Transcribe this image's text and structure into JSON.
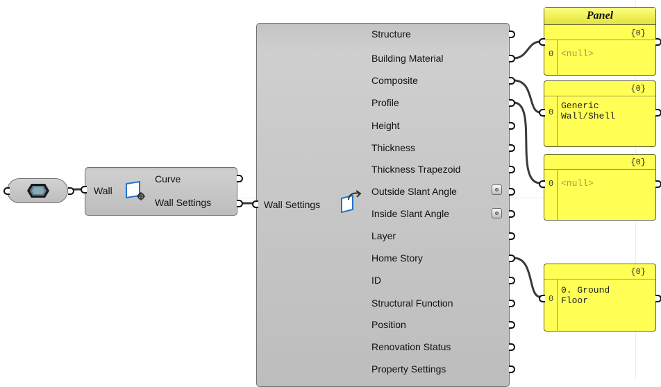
{
  "app": {
    "name": "Grasshopper canvas"
  },
  "source_component": {
    "icon": "archicad-element-icon"
  },
  "wall_settings_component": {
    "input_label": "Wall",
    "outputs": [
      "Curve",
      "Wall Settings"
    ],
    "icon": "wall-settings-icon"
  },
  "deconstruct_component": {
    "input_label": "Wall Settings",
    "icon": "deconstruct-wall-icon",
    "outputs": [
      "Structure",
      "Building Material",
      "Composite",
      "Profile",
      "Height",
      "Thickness",
      "Thickness Trapezoid",
      "Outside Slant Angle",
      "Inside Slant Angle",
      "Layer",
      "Home Story",
      "ID",
      "Structural Function",
      "Position",
      "Renovation Status",
      "Property Settings"
    ]
  },
  "panels": [
    {
      "title": "Panel",
      "path": "{0}",
      "index": "0",
      "text": "<null>",
      "is_null": true
    },
    {
      "title": "",
      "path": "{0}",
      "index": "0",
      "text": "Generic\nWall/Shell",
      "is_null": false
    },
    {
      "title": "",
      "path": "{0}",
      "index": "0",
      "text": "<null>",
      "is_null": true
    },
    {
      "title": "",
      "path": "{0}",
      "index": "0",
      "text": "0. Ground\nFloor",
      "is_null": false
    }
  ],
  "colors": {
    "panel": "#ffff55",
    "component": "#c8c8c8",
    "wire": "#3a3a3a"
  }
}
